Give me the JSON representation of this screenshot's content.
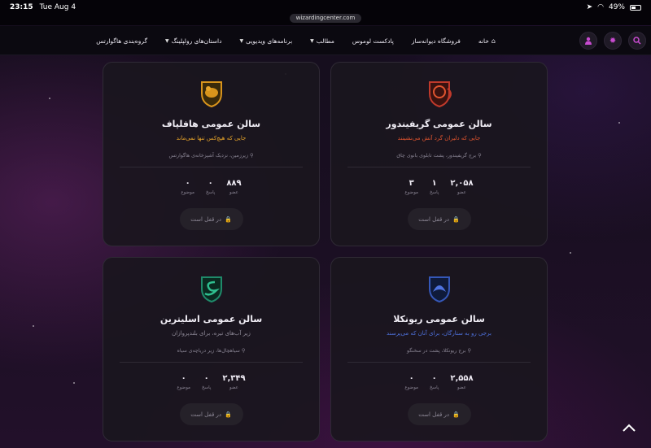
{
  "status": {
    "time": "23:15",
    "date": "Tue Aug 4",
    "battery": "49%"
  },
  "browser": {
    "url": "wizardingcenter.com"
  },
  "nav": {
    "links": [
      {
        "label": "خانه",
        "icon": "home-icon"
      },
      {
        "label": "فروشگاه دیوانه‌ساز"
      },
      {
        "label": "پادکست لوموس"
      },
      {
        "label": "مطالب",
        "dropdown": true
      },
      {
        "label": "برنامه‌های ویدیویی",
        "dropdown": true
      },
      {
        "label": "داستان‌های رولپلینگ",
        "dropdown": true
      },
      {
        "label": "گروه‌بندی هاگوارتس"
      }
    ],
    "icons": [
      "search-icon",
      "settings-icon",
      "user-icon"
    ]
  },
  "cards": [
    {
      "title": "سالن عمومی گریفیندور",
      "motto": "جایی که دلیران گرد آتش می‌نشینند",
      "motto_color": "#e0542f",
      "location": "برج گریفیندور، پشت تابلوی بانوی چاق",
      "stats": [
        {
          "n": "۳",
          "l": "موضوع"
        },
        {
          "n": "۱",
          "l": "پاسخ"
        },
        {
          "n": "۲,۰۵۸",
          "l": "عضو"
        }
      ],
      "lock": "در قفل است",
      "crest_color": "#c0392b"
    },
    {
      "title": "سالن عمومی هافلپاف",
      "motto": "جایی که هیچ‌کس تنها نمی‌ماند",
      "motto_color": "#e8a52a",
      "location": "زیرزمین، نزدیک آشپزخانه‌ی هاگوارتس",
      "stats": [
        {
          "n": "۰",
          "l": "موضوع"
        },
        {
          "n": "۰",
          "l": "پاسخ"
        },
        {
          "n": "۸۸۹",
          "l": "عضو"
        }
      ],
      "lock": "در قفل است",
      "crest_color": "#d8941c"
    },
    {
      "title": "سالن عمومی ریونکلا",
      "motto": "برجی رو به ستارگان، برای آنان که می‌پرسند",
      "motto_color": "#4f73e0",
      "location": "برج ریونکلا، پشت در سخنگو",
      "stats": [
        {
          "n": "۰",
          "l": "موضوع"
        },
        {
          "n": "۰",
          "l": "پاسخ"
        },
        {
          "n": "۲,۵۵۸",
          "l": "عضو"
        }
      ],
      "lock": "در قفل است",
      "crest_color": "#3557b8"
    },
    {
      "title": "سالن عمومی اسلیترین",
      "motto": "زیر آب‌های تیره، برای بلندپروازان",
      "motto_color": "#8f8a98",
      "location": "سیاهچال‌ها، زیر دریاچه‌ی سیاه",
      "stats": [
        {
          "n": "۰",
          "l": "موضوع"
        },
        {
          "n": "۰",
          "l": "پاسخ"
        },
        {
          "n": "۲,۳۴۹",
          "l": "عضو"
        }
      ],
      "lock": "در قفل است",
      "crest_color": "#1f8a6a"
    }
  ]
}
